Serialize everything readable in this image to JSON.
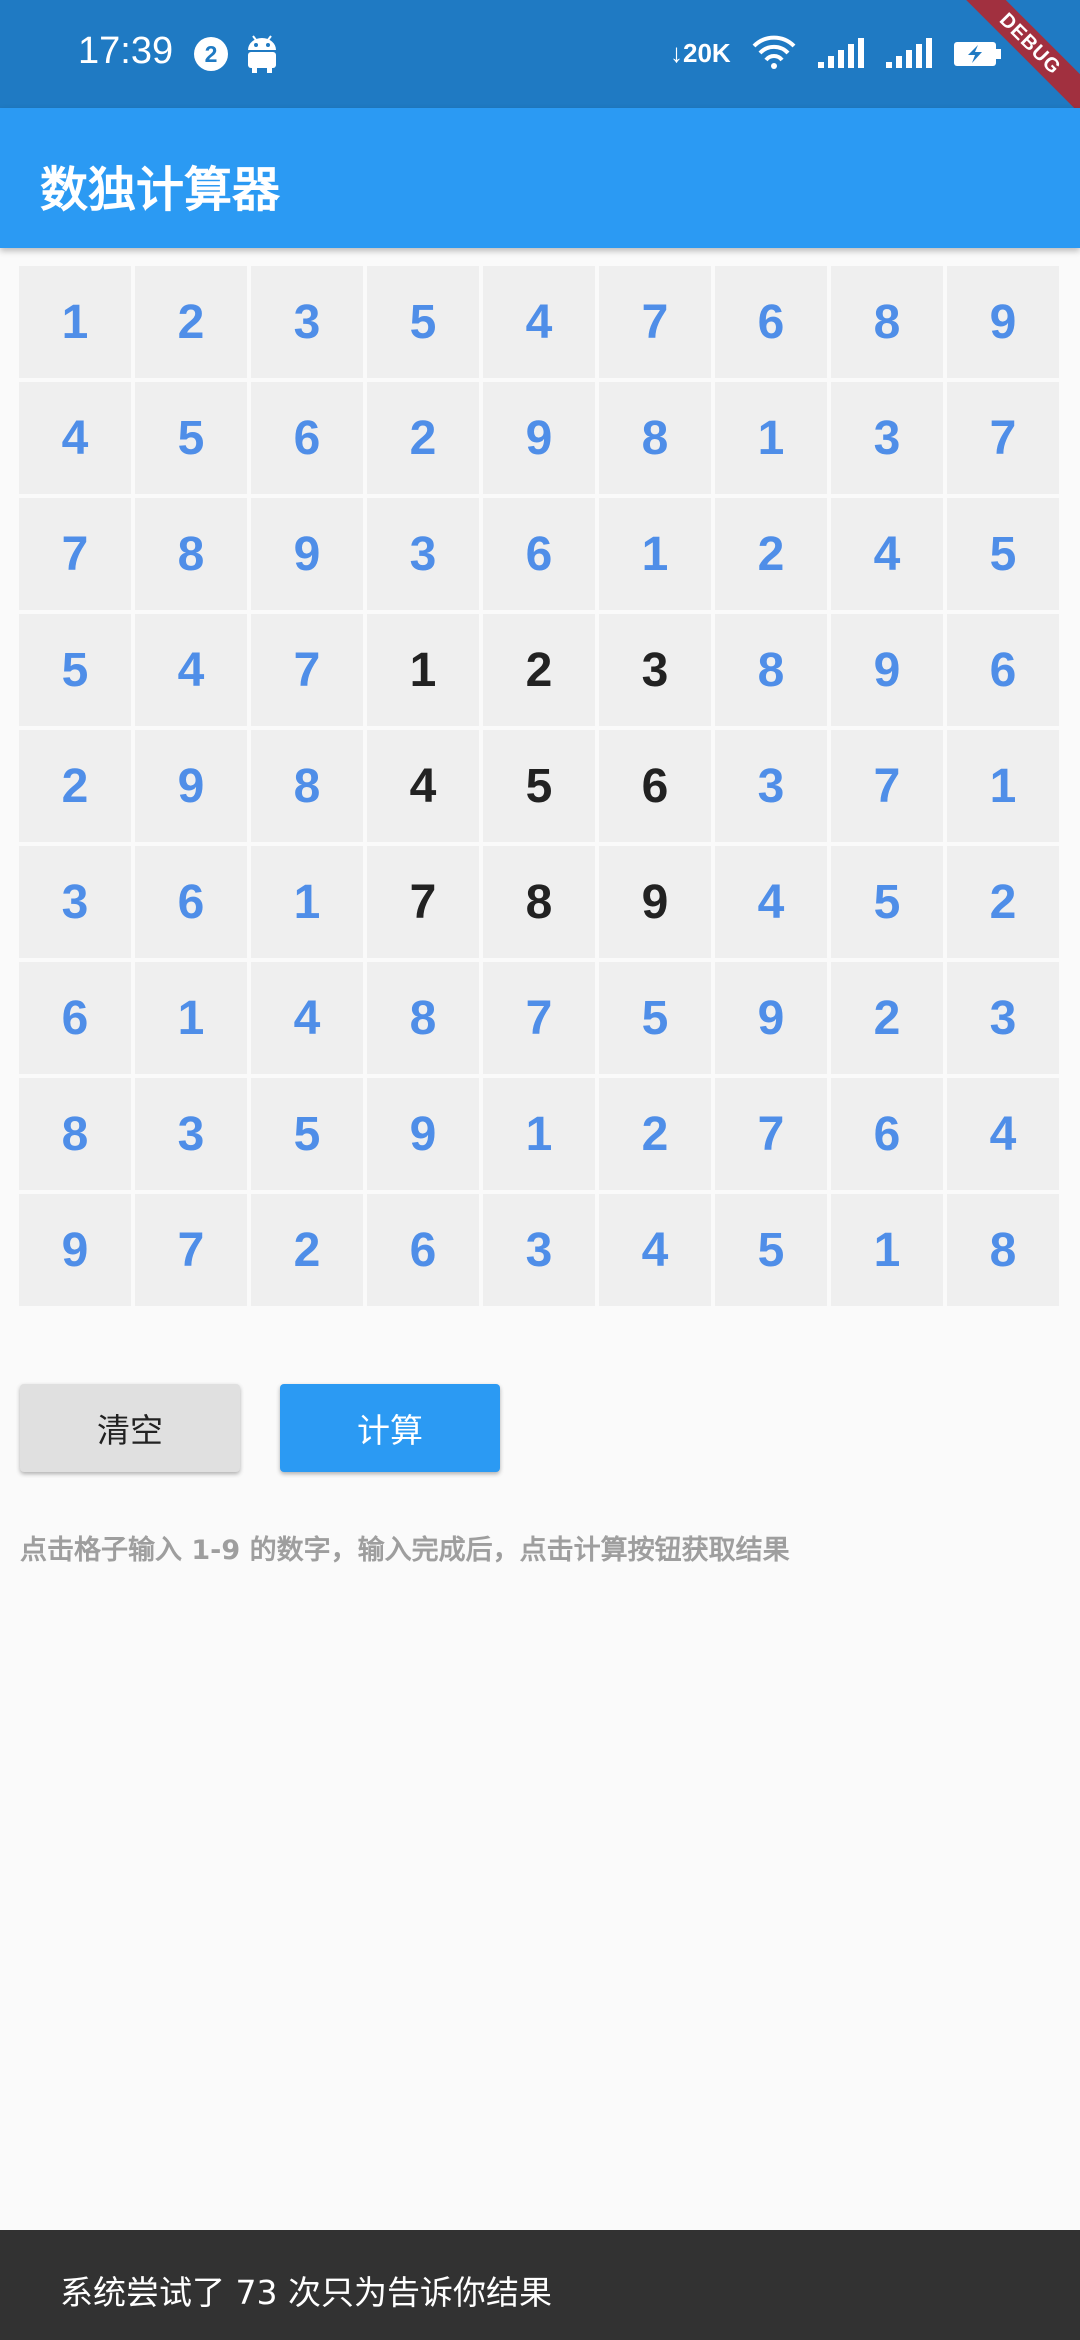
{
  "status_bar": {
    "time": "17:39",
    "notification_count": "2",
    "net_speed": "20K",
    "debug_label": "DEBUG",
    "icons": [
      "android-icon",
      "download-arrow-icon",
      "wifi-icon",
      "signal-icon",
      "signal-icon-2",
      "battery-charging-icon"
    ]
  },
  "app_bar": {
    "title": "数独计算器"
  },
  "grid": {
    "values": [
      [
        "1",
        "2",
        "3",
        "5",
        "4",
        "7",
        "6",
        "8",
        "9"
      ],
      [
        "4",
        "5",
        "6",
        "2",
        "9",
        "8",
        "1",
        "3",
        "7"
      ],
      [
        "7",
        "8",
        "9",
        "3",
        "6",
        "1",
        "2",
        "4",
        "5"
      ],
      [
        "5",
        "4",
        "7",
        "1",
        "2",
        "3",
        "8",
        "9",
        "6"
      ],
      [
        "2",
        "9",
        "8",
        "4",
        "5",
        "6",
        "3",
        "7",
        "1"
      ],
      [
        "3",
        "6",
        "1",
        "7",
        "8",
        "9",
        "4",
        "5",
        "2"
      ],
      [
        "6",
        "1",
        "4",
        "8",
        "7",
        "5",
        "9",
        "2",
        "3"
      ],
      [
        "8",
        "3",
        "5",
        "9",
        "1",
        "2",
        "7",
        "6",
        "4"
      ],
      [
        "9",
        "7",
        "2",
        "6",
        "3",
        "4",
        "5",
        "1",
        "8"
      ]
    ],
    "given_color": "#222222",
    "computed_color": "#4f8ee8"
  },
  "buttons": {
    "clear_label": "清空",
    "calc_label": "计算"
  },
  "hint": "点击格子输入 1-9 的数字，输入完成后，点击计算按钮获取结果",
  "snackbar": {
    "message": "系统尝试了 73 次只为告诉你结果"
  },
  "colors": {
    "app_bar": "#2b9af3",
    "status_bar": "#1f7ac3",
    "primary_button": "#2b9af3"
  }
}
